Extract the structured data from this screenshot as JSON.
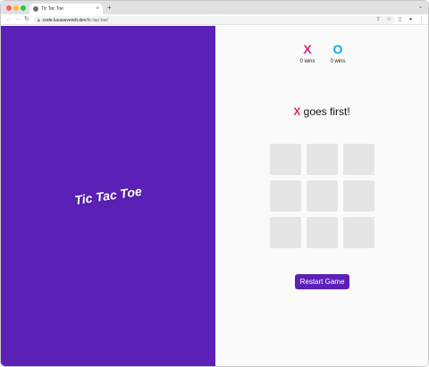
{
  "browser": {
    "tab_title": "Tic Tac Toe",
    "tab_close": "×",
    "new_tab": "+",
    "url_host": "code.lucaseverett.dev",
    "url_path": "/tic-tac-toe/",
    "icons": [
      "back-arrow-icon",
      "forward-arrow-icon",
      "reload-icon",
      "lock-icon",
      "share-icon",
      "star-icon",
      "sidebar-icon",
      "profile-icon",
      "menu-icon"
    ]
  },
  "app": {
    "brand": "Tic Tac Toe",
    "scores": [
      {
        "mark": "X",
        "wins": "0 wins"
      },
      {
        "mark": "O",
        "wins": "0 wins"
      }
    ],
    "turn_mark": "X",
    "turn_text": " goes first!",
    "board": [
      "",
      "",
      "",
      "",
      "",
      "",
      "",
      "",
      ""
    ],
    "restart_label": "Restart Game"
  },
  "colors": {
    "primary": "#5b21b6",
    "x_color": "#db2777",
    "o_color": "#0ea5e9",
    "cell": "#e5e5e5"
  }
}
